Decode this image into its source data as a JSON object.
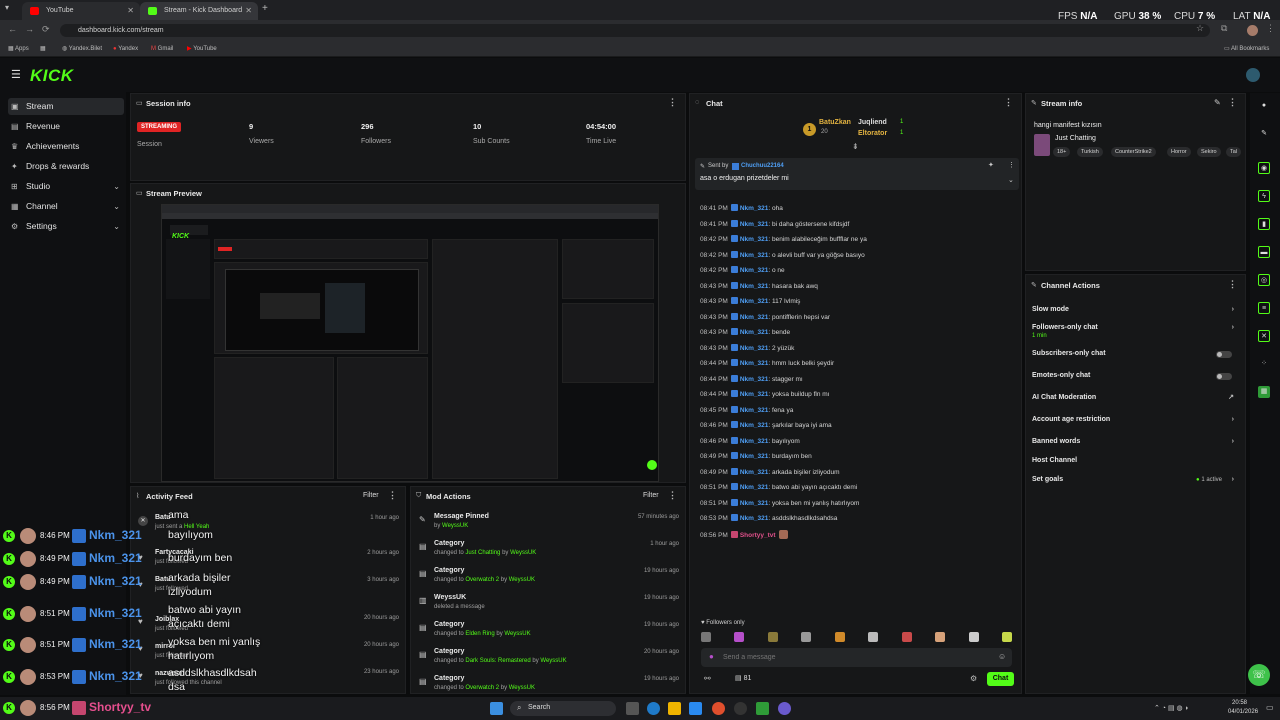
{
  "browser": {
    "tabs": [
      {
        "title": "YouTube",
        "color": "#ff0000"
      },
      {
        "title": "Stream - Kick Dashboard",
        "color": "#53fc18"
      }
    ],
    "url": "dashboard.kick.com/stream",
    "bookmarks": [
      "Apps",
      "Yandex.Bilet",
      "Yandex",
      "Gmail",
      "YouTube"
    ],
    "all_bookmarks": "All Bookmarks"
  },
  "perf": {
    "fps_label": "FPS",
    "fps": "N/A",
    "gpu_label": "GPU",
    "gpu": "38 %",
    "cpu_label": "CPU",
    "cpu": "7 %",
    "lat_label": "LAT",
    "lat": "N/A"
  },
  "app": {
    "logo": "KICK",
    "sidebar": [
      {
        "label": "Stream",
        "icon": "video-icon",
        "active": true
      },
      {
        "label": "Revenue",
        "icon": "dollar-icon"
      },
      {
        "label": "Achievements",
        "icon": "trophy-icon"
      },
      {
        "label": "Drops & rewards",
        "icon": "gift-icon"
      },
      {
        "label": "Studio",
        "icon": "studio-icon",
        "expand": true
      },
      {
        "label": "Channel",
        "icon": "channel-icon",
        "expand": true
      },
      {
        "label": "Settings",
        "icon": "gear-icon",
        "expand": true
      }
    ]
  },
  "session": {
    "title": "Session info",
    "status": "STREAMING",
    "status_label": "Session",
    "stats": [
      {
        "value": "9",
        "label": "Viewers"
      },
      {
        "value": "296",
        "label": "Followers"
      },
      {
        "value": "10",
        "label": "Sub Counts"
      },
      {
        "value": "04:54:00",
        "label": "Time Live"
      }
    ]
  },
  "preview": {
    "title": "Stream Preview"
  },
  "activity": {
    "title": "Activity Feed",
    "filter": "Filter",
    "items": [
      {
        "user": "Batu",
        "text": "just sent a",
        "highlight": "Hell Yeah",
        "time": "1 hour ago"
      },
      {
        "user": "Fartycacaki",
        "text": "just followed",
        "highlight": "",
        "time": "2 hours ago"
      },
      {
        "user": "Batu",
        "text": "just followed",
        "highlight": "",
        "time": "3 hours ago"
      },
      {
        "user": "Joiblax",
        "text": "just followed",
        "highlight": "",
        "time": "20 hours ago"
      },
      {
        "user": "mirror",
        "text": "just followed",
        "highlight": "",
        "time": "20 hours ago"
      },
      {
        "user": "nazwann",
        "text": "just followed this channel",
        "highlight": "",
        "time": "23 hours ago"
      }
    ]
  },
  "mod": {
    "title": "Mod Actions",
    "filter": "Filter",
    "items": [
      {
        "title": "Message Pinned",
        "line": "by",
        "a": "",
        "by": "WeyssUK",
        "time": "57 minutes ago"
      },
      {
        "title": "Category",
        "line": "changed to",
        "a": "Just Chatting",
        "by": "WeyssUK",
        "time": "1 hour ago"
      },
      {
        "title": "Category",
        "line": "changed to",
        "a": "Overwatch 2",
        "by": "WeyssUK",
        "time": "19 hours ago"
      },
      {
        "title": "WeyssUK",
        "line": "deleted a message",
        "a": "",
        "by": "",
        "time": "19 hours ago"
      },
      {
        "title": "Category",
        "line": "changed to",
        "a": "Elden Ring",
        "by": "WeyssUK",
        "time": "19 hours ago"
      },
      {
        "title": "Category",
        "line": "changed to",
        "a": "Dark Souls: Remastered",
        "by": "WeyssUK",
        "time": "20 hours ago"
      },
      {
        "title": "Category",
        "line": "changed to",
        "a": "Overwatch 2",
        "by": "WeyssUK",
        "time": "19 hours ago"
      }
    ]
  },
  "chat": {
    "title": "Chat",
    "top_users": [
      {
        "name": "BatuZkan",
        "count": "20"
      },
      {
        "name": "Juqliend",
        "count": "1"
      },
      {
        "name": "Eltorator",
        "count": "1"
      }
    ],
    "pinned": {
      "sent_by": "Sent by",
      "user": "Chuchuu22164",
      "text": "asa o erdugan prizetdeler mi"
    },
    "lines": [
      {
        "time": "08:41 PM",
        "user": "Nkm_321",
        "msg": "oha"
      },
      {
        "time": "08:41 PM",
        "user": "Nkm_321",
        "msg": "bi daha göstersene kifdsjdf"
      },
      {
        "time": "08:42 PM",
        "user": "Nkm_321",
        "msg": "benim alabileceğim buffflar ne ya"
      },
      {
        "time": "08:42 PM",
        "user": "Nkm_321",
        "msg": "o alevli buff var ya göğse basıyo"
      },
      {
        "time": "08:42 PM",
        "user": "Nkm_321",
        "msg": "o ne"
      },
      {
        "time": "08:43 PM",
        "user": "Nkm_321",
        "msg": "hasara bak awq"
      },
      {
        "time": "08:43 PM",
        "user": "Nkm_321",
        "msg": "117 lvlmiş"
      },
      {
        "time": "08:43 PM",
        "user": "Nkm_321",
        "msg": "pontifflerin hepsi var"
      },
      {
        "time": "08:43 PM",
        "user": "Nkm_321",
        "msg": "bende"
      },
      {
        "time": "08:43 PM",
        "user": "Nkm_321",
        "msg": "2 yüzük"
      },
      {
        "time": "08:44 PM",
        "user": "Nkm_321",
        "msg": "hmm luck belki şeydir"
      },
      {
        "time": "08:44 PM",
        "user": "Nkm_321",
        "msg": "stagger mı"
      },
      {
        "time": "08:44 PM",
        "user": "Nkm_321",
        "msg": "yoksa buildup fln mı"
      },
      {
        "time": "08:45 PM",
        "user": "Nkm_321",
        "msg": "fena ya"
      },
      {
        "time": "08:46 PM",
        "user": "Nkm_321",
        "msg": "şarkılar baya iyi ama"
      },
      {
        "time": "08:46 PM",
        "user": "Nkm_321",
        "msg": "bayılıyom"
      },
      {
        "time": "08:49 PM",
        "user": "Nkm_321",
        "msg": "burdayım ben"
      },
      {
        "time": "08:49 PM",
        "user": "Nkm_321",
        "msg": "arkada bişiler izliyodum"
      },
      {
        "time": "08:51 PM",
        "user": "Nkm_321",
        "msg": "batwo abi yayın açıcaktı demi"
      },
      {
        "time": "08:51 PM",
        "user": "Nkm_321",
        "msg": "yoksa ben mi yanlış hatırlıyom"
      },
      {
        "time": "08:53 PM",
        "user": "Nkm_321",
        "msg": "asddslkhasdlkdsahdsa"
      },
      {
        "time": "08:56 PM",
        "user": "Shortyy_tvt",
        "msg": ""
      }
    ],
    "followers_only": "Followers only",
    "placeholder": "Send a message",
    "viewer_count": "81",
    "send": "Chat"
  },
  "stream_info": {
    "title": "Stream info",
    "stream_title": "hangi manifest kızısın",
    "category": "Just Chatting",
    "tags": [
      "18+",
      "Turkish",
      "CounterStrike2",
      "Horror",
      "Sekiro",
      "Tal"
    ]
  },
  "channel_actions": {
    "title": "Channel Actions",
    "items": [
      {
        "label": "Slow mode",
        "kind": "arrow",
        "sub": ""
      },
      {
        "label": "Followers-only chat",
        "kind": "arrow",
        "sub": "1 min"
      },
      {
        "label": "Subscribers-only chat",
        "kind": "toggle",
        "sub": ""
      },
      {
        "label": "Emotes-only chat",
        "kind": "toggle",
        "sub": ""
      },
      {
        "label": "AI Chat Moderation",
        "kind": "link",
        "sub": ""
      },
      {
        "label": "Account age restriction",
        "kind": "arrow",
        "sub": ""
      },
      {
        "label": "Banned words",
        "kind": "arrow",
        "sub": ""
      },
      {
        "label": "Host Channel",
        "kind": "none",
        "sub": ""
      },
      {
        "label": "Set goals",
        "kind": "arrow",
        "sub": "",
        "extra": "1 active"
      }
    ]
  },
  "overlay": {
    "rows": [
      {
        "time": "8:46 PM",
        "user": "Nkm_321"
      },
      {
        "time": "8:49 PM",
        "user": "Nkm_321"
      },
      {
        "time": "8:49 PM",
        "user": "Nkm_321"
      },
      {
        "time": "8:51 PM",
        "user": "Nkm_321"
      },
      {
        "time": "8:51 PM",
        "user": "Nkm_321"
      },
      {
        "time": "8:53 PM",
        "user": "Nkm_321"
      },
      {
        "time": "8:56 PM",
        "user": "Shortyy_tv"
      }
    ],
    "messages": [
      "ama",
      "bayılıyom",
      "burdayım ben",
      "arkada bişiler",
      "izliyodum",
      "batwo abi yayın",
      "açıcaktı demi",
      "yoksa ben mi yanlış",
      "hatırlıyom",
      "asddslkhasdlkdsah",
      "dsa"
    ]
  },
  "taskbar": {
    "search": "Search",
    "clock_time": "20:58",
    "clock_date": "04/01/2026"
  }
}
